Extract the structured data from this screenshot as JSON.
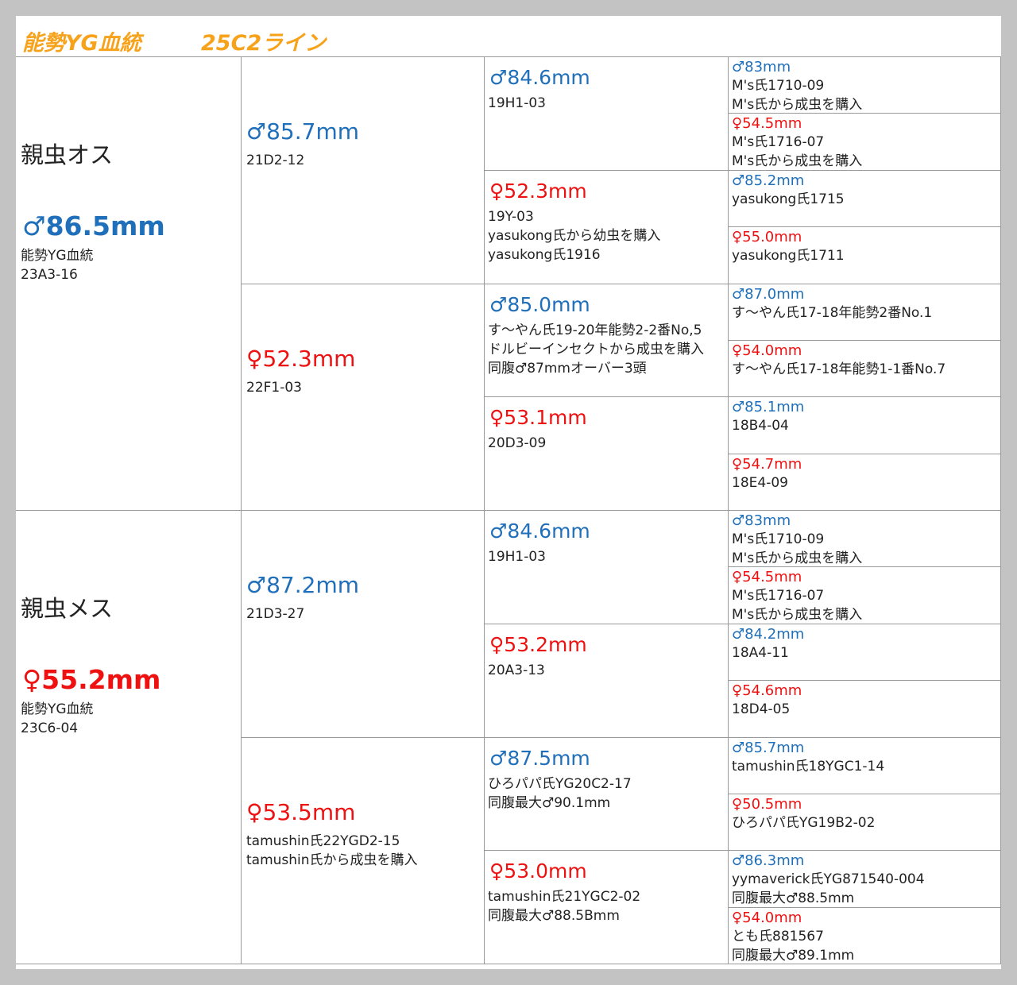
{
  "header": {
    "title": "能勢YG血統",
    "line": "25C2ライン"
  },
  "sire": {
    "role": "親虫オス",
    "size": "♂86.5mm",
    "lines": [
      "能勢YG血統",
      "23A3-16"
    ],
    "father": {
      "size": "♂85.7mm",
      "lines": [
        "21D2-12"
      ],
      "father": {
        "size": "♂84.6mm",
        "lines": [
          "19H1-03"
        ],
        "father": {
          "size": "♂83mm",
          "lines": [
            "M's氏1710-09",
            "M's氏から成虫を購入"
          ]
        },
        "mother": {
          "size": "♀54.5mm",
          "lines": [
            "M's氏1716-07",
            "M's氏から成虫を購入"
          ]
        }
      },
      "mother": {
        "size": "♀52.3mm",
        "lines": [
          "19Y-03",
          "yasukong氏から幼虫を購入",
          "yasukong氏1916"
        ],
        "father": {
          "size": "♂85.2mm",
          "lines": [
            "yasukong氏1715"
          ]
        },
        "mother": {
          "size": "♀55.0mm",
          "lines": [
            "yasukong氏1711"
          ]
        }
      }
    },
    "mother": {
      "size": "♀52.3mm",
      "lines": [
        "22F1-03"
      ],
      "father": {
        "size": "♂85.0mm",
        "lines": [
          "す～やん氏19-20年能勢2-2番No,5",
          "ドルビーインセクトから成虫を購入",
          "同腹♂87mmオーバー3頭"
        ],
        "father": {
          "size": "♂87.0mm",
          "lines": [
            "す～やん氏17-18年能勢2番No.1"
          ]
        },
        "mother": {
          "size": "♀54.0mm",
          "lines": [
            "す～やん氏17-18年能勢1-1番No.7"
          ]
        }
      },
      "mother": {
        "size": "♀53.1mm",
        "lines": [
          "20D3-09"
        ],
        "father": {
          "size": "♂85.1mm",
          "lines": [
            "18B4-04"
          ]
        },
        "mother": {
          "size": "♀54.7mm",
          "lines": [
            "18E4-09"
          ]
        }
      }
    }
  },
  "dam": {
    "role": "親虫メス",
    "size": "♀55.2mm",
    "lines": [
      "能勢YG血統",
      "23C6-04"
    ],
    "father": {
      "size": "♂87.2mm",
      "lines": [
        "21D3-27"
      ],
      "father": {
        "size": "♂84.6mm",
        "lines": [
          "19H1-03"
        ],
        "father": {
          "size": "♂83mm",
          "lines": [
            "M's氏1710-09",
            "M's氏から成虫を購入"
          ]
        },
        "mother": {
          "size": "♀54.5mm",
          "lines": [
            "M's氏1716-07",
            "M's氏から成虫を購入"
          ]
        }
      },
      "mother": {
        "size": "♀53.2mm",
        "lines": [
          "20A3-13"
        ],
        "father": {
          "size": "♂84.2mm",
          "lines": [
            "18A4-11"
          ]
        },
        "mother": {
          "size": "♀54.6mm",
          "lines": [
            "18D4-05"
          ]
        }
      }
    },
    "mother": {
      "size": "♀53.5mm",
      "lines": [
        "tamushin氏22YGD2-15",
        "tamushin氏から成虫を購入"
      ],
      "father": {
        "size": "♂87.5mm",
        "lines": [
          "ひろパパ氏YG20C2-17",
          "同腹最大♂90.1mm"
        ],
        "father": {
          "size": "♂85.7mm",
          "lines": [
            "tamushin氏18YGC1-14"
          ]
        },
        "mother": {
          "size": "♀50.5mm",
          "lines": [
            "ひろパパ氏YG19B2-02"
          ]
        }
      },
      "mother": {
        "size": "♀53.0mm",
        "lines": [
          "tamushin氏21YGC2-02",
          "同腹最大♂88.5Bmm"
        ],
        "father": {
          "size": "♂86.3mm",
          "lines": [
            "yymaverick氏YG871540-004",
            "同腹最大♂88.5mm"
          ]
        },
        "mother": {
          "size": "♀54.0mm",
          "lines": [
            "とも氏881567",
            "同腹最大♂89.1mm"
          ]
        }
      }
    }
  },
  "colors": {
    "male": "#1f6fba",
    "female": "#ee1111",
    "title": "#f7a21b"
  }
}
